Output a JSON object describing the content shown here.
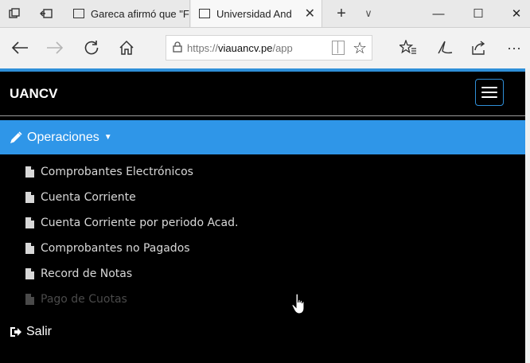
{
  "browser": {
    "tabs": [
      {
        "label": "Gareca afirmó que \"F",
        "active": false
      },
      {
        "label": "Universidad And",
        "active": true
      }
    ],
    "new_tab_symbol": "+",
    "tab_list_symbol": "∨",
    "window_controls": {
      "minimize": "—",
      "maximize": "☐",
      "close": "✕"
    },
    "address": {
      "url_prefix": "https://",
      "url_domain": "viauancv.pe",
      "url_path": "/app"
    },
    "toolbar_icons": [
      "back-icon",
      "forward-icon",
      "refresh-icon",
      "home-icon",
      "lock-icon",
      "reading-view-icon",
      "favorite-star-icon",
      "favorites-hub-icon",
      "web-note-icon",
      "share-icon",
      "more-icon"
    ],
    "more_symbol": "···"
  },
  "app": {
    "brand": "UANCV",
    "section": {
      "label": "Operaciones",
      "icon": "pencil-icon"
    },
    "menu_items": [
      {
        "label": "Comprobantes Electrónicos",
        "icon": "file-icon",
        "dimmed": false
      },
      {
        "label": "Cuenta Corriente",
        "icon": "file-icon",
        "dimmed": false
      },
      {
        "label": "Cuenta Corriente por periodo Acad.",
        "icon": "file-icon",
        "dimmed": false
      },
      {
        "label": "Comprobantes no Pagados",
        "icon": "file-icon",
        "dimmed": false
      },
      {
        "label": "Record de Notas",
        "icon": "file-icon",
        "dimmed": false
      },
      {
        "label": "Pago de Cuotas",
        "icon": "file-icon",
        "dimmed": true
      }
    ],
    "logout": {
      "label": "Salir",
      "icon": "sign-out-icon"
    }
  },
  "colors": {
    "accent_blue": "#2f96e8",
    "page_background": "#000000",
    "menu_text": "#d8d8d8",
    "menu_text_dimmed": "#4a4a4a"
  }
}
